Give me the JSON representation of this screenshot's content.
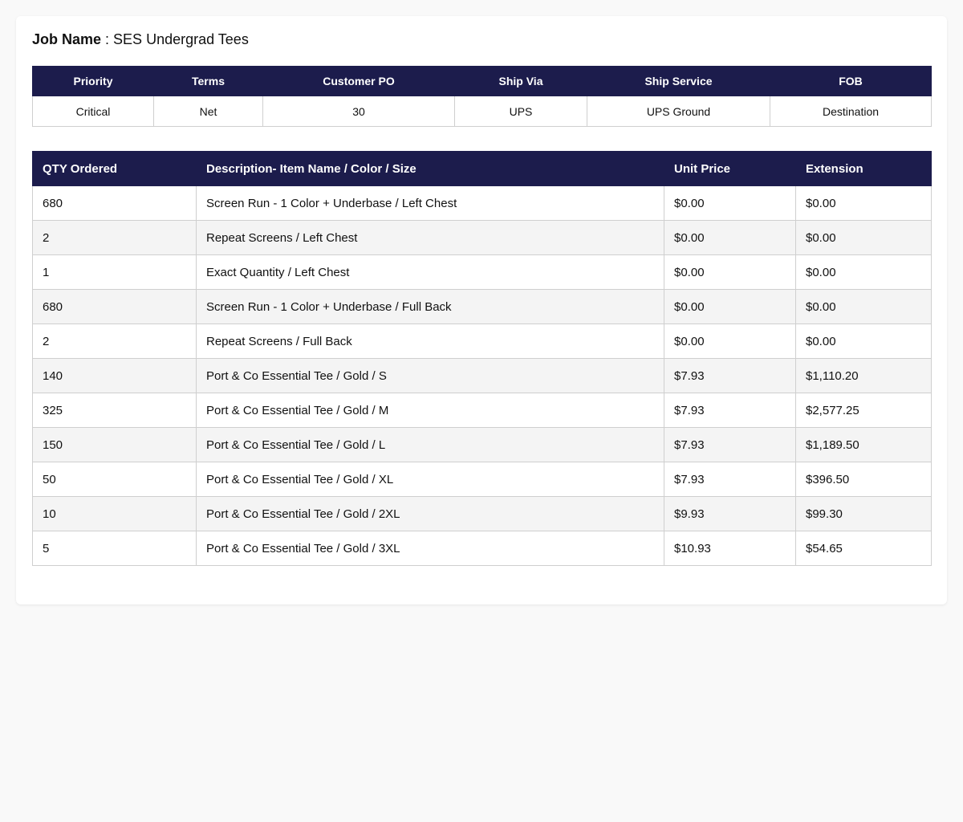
{
  "job": {
    "label": "Job Name",
    "separator": " : ",
    "value": "SES Undergrad Tees"
  },
  "info": {
    "headers": [
      "Priority",
      "Terms",
      "Customer PO",
      "Ship Via",
      "Ship Service",
      "FOB"
    ],
    "values": [
      "Critical",
      "Net",
      "30",
      "UPS",
      "UPS Ground",
      "Destination"
    ]
  },
  "colors": {
    "header_bg": "#1c1c4c",
    "header_text": "#ffffff",
    "row_alt": "#f4f4f4"
  },
  "items": {
    "headers": [
      "QTY Ordered",
      "Description- Item Name / Color / Size",
      "Unit Price",
      "Extension"
    ],
    "rows": [
      {
        "qty": "680",
        "desc": "Screen Run - 1 Color + Underbase / Left Chest",
        "price": "$0.00",
        "ext": "$0.00"
      },
      {
        "qty": "2",
        "desc": "Repeat Screens / Left Chest",
        "price": "$0.00",
        "ext": "$0.00"
      },
      {
        "qty": "1",
        "desc": "Exact Quantity / Left Chest",
        "price": "$0.00",
        "ext": "$0.00"
      },
      {
        "qty": "680",
        "desc": "Screen Run - 1 Color + Underbase / Full Back",
        "price": "$0.00",
        "ext": "$0.00"
      },
      {
        "qty": "2",
        "desc": "Repeat Screens / Full Back",
        "price": "$0.00",
        "ext": "$0.00"
      },
      {
        "qty": "140",
        "desc": "Port & Co Essential Tee / Gold / S",
        "price": "$7.93",
        "ext": "$1,110.20"
      },
      {
        "qty": "325",
        "desc": "Port & Co Essential Tee / Gold / M",
        "price": "$7.93",
        "ext": "$2,577.25"
      },
      {
        "qty": "150",
        "desc": "Port & Co Essential Tee / Gold / L",
        "price": "$7.93",
        "ext": "$1,189.50"
      },
      {
        "qty": "50",
        "desc": "Port & Co Essential Tee / Gold / XL",
        "price": "$7.93",
        "ext": "$396.50"
      },
      {
        "qty": "10",
        "desc": "Port & Co Essential Tee / Gold / 2XL",
        "price": "$9.93",
        "ext": "$99.30"
      },
      {
        "qty": "5",
        "desc": "Port & Co Essential Tee / Gold / 3XL",
        "price": "$10.93",
        "ext": "$54.65"
      }
    ]
  }
}
